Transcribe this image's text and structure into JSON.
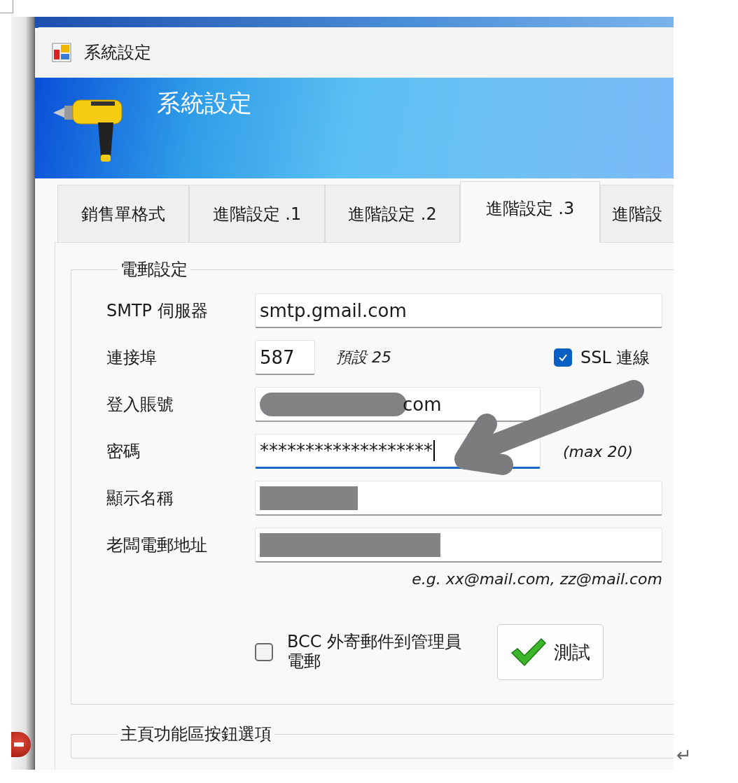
{
  "window": {
    "title": "系統設定"
  },
  "banner": {
    "title": "系統設定"
  },
  "tabs": [
    {
      "label": "銷售單格式",
      "selected": false
    },
    {
      "label": "進階設定 .1",
      "selected": false
    },
    {
      "label": "進階設定 .2",
      "selected": false
    },
    {
      "label": "進階設定 .3",
      "selected": true
    },
    {
      "label": "進階設",
      "selected": false
    }
  ],
  "email_settings": {
    "legend": "電郵設定",
    "smtp": {
      "label": "SMTP 伺服器",
      "value": "smtp.gmail.com"
    },
    "port": {
      "label": "連接埠",
      "value": "587",
      "note": "預設 25"
    },
    "ssl": {
      "label": "SSL 連線",
      "checked": true
    },
    "login": {
      "label": "登入賬號",
      "value": "com",
      "redacted": true
    },
    "password": {
      "label": "密碼",
      "value": "*******************",
      "focused": true,
      "note": "(max 20)"
    },
    "display_name": {
      "label": "顯示名稱",
      "redacted": true
    },
    "boss_email": {
      "label": "老闆電郵地址",
      "redacted": true,
      "hint": "e.g. xx@mail.com, zz@mail.com"
    },
    "bcc": {
      "label": "BCC 外寄郵件到管理員電郵",
      "checked": false
    },
    "test_button": {
      "label": "測試"
    }
  },
  "ribbon_options": {
    "legend": "主頁功能區按鈕選項"
  },
  "paragraph_mark": "↵"
}
